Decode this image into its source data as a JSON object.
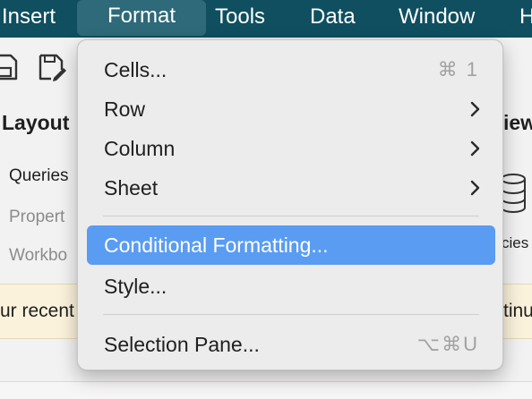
{
  "menubar": {
    "items": [
      "Insert",
      "Format",
      "Tools",
      "Data",
      "Window",
      "H"
    ],
    "active": "Format"
  },
  "background": {
    "heading_left": "Layout",
    "heading_right": "iew",
    "items": [
      "Queries",
      "Propert",
      "Workbo"
    ],
    "icon_caption": "cies",
    "notice_left": "ur recent",
    "notice_right": "tinu"
  },
  "dropdown": {
    "items": [
      {
        "label": "Cells...",
        "shortcut": "⌘ 1",
        "submenu": false
      },
      {
        "label": "Row",
        "shortcut": "",
        "submenu": true
      },
      {
        "label": "Column",
        "shortcut": "",
        "submenu": true
      },
      {
        "label": "Sheet",
        "shortcut": "",
        "submenu": true
      },
      {
        "label": "Conditional Formatting...",
        "shortcut": "",
        "submenu": false,
        "highlighted": true
      },
      {
        "label": "Style...",
        "shortcut": "",
        "submenu": false
      },
      {
        "label": "Selection Pane...",
        "shortcut": "⌥⌘U",
        "submenu": false
      }
    ]
  },
  "colors": {
    "menubar": "#0f4f60",
    "menubar_active": "#2e6a79",
    "highlight": "#5a9cf2",
    "notice": "#fbf2dc"
  },
  "icons": [
    "save-icon",
    "save-as-icon",
    "chevron-right-icon",
    "database-icon"
  ]
}
